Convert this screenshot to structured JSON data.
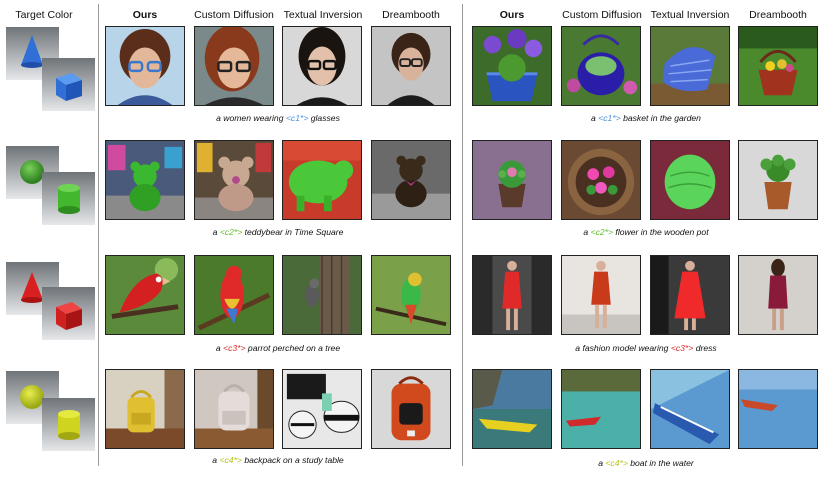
{
  "headers": {
    "target_color": "Target Color",
    "left": [
      "Ours",
      "Custom Diffusion",
      "Textual Inversion",
      "Dreambooth"
    ],
    "right": [
      "Ours",
      "Custom Diffusion",
      "Textual Inversion",
      "Dreambooth"
    ]
  },
  "token_colors": {
    "c1": "#4a90d9",
    "c2": "#5fbf2a",
    "c3": "#d62a2a",
    "c4": "#b8c21a"
  },
  "rows": [
    {
      "swatch_color": "blue",
      "left_caption": {
        "pre": "a women wearing ",
        "token": "<c1*>",
        "post": " glasses"
      },
      "right_caption": {
        "pre": "a ",
        "token": "<c1*>",
        "post": " basket in the garden"
      }
    },
    {
      "swatch_color": "green",
      "left_caption": {
        "pre": "a  ",
        "token": "<c2*>",
        "post": " teddybear in Time Square"
      },
      "right_caption": {
        "pre": "a  ",
        "token": "<c2*>",
        "post": " flower in the wooden pot"
      }
    },
    {
      "swatch_color": "red",
      "left_caption": {
        "pre": "a  ",
        "token": "<c3*>",
        "post": " parrot perched on a tree"
      },
      "right_caption": {
        "pre": "a fashion model wearing ",
        "token": "<c3*>",
        "post": " dress"
      }
    },
    {
      "swatch_color": "yellow-green",
      "left_caption": {
        "pre": "a ",
        "token": "<c4*>",
        "post": " backpack on a study table"
      },
      "right_caption": {
        "pre": "a  ",
        "token": "<c4*>",
        "post": " boat in the water"
      }
    }
  ]
}
